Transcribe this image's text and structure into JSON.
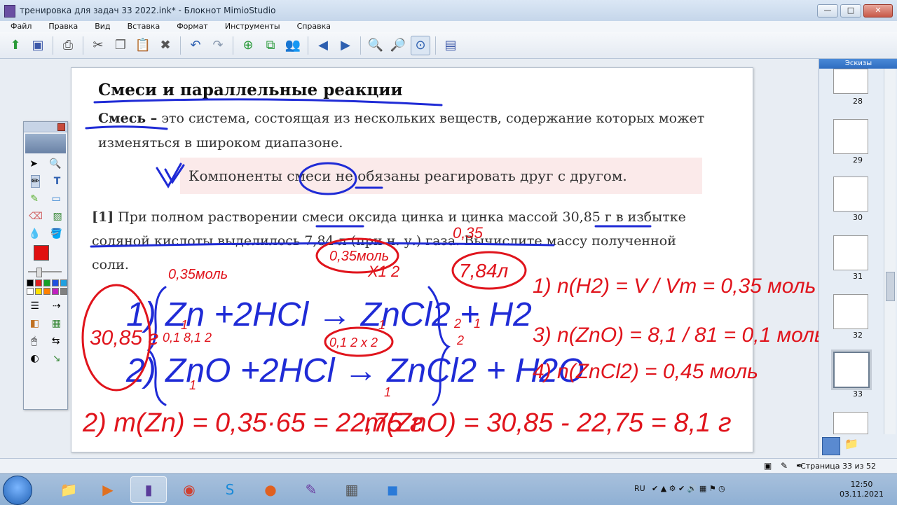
{
  "window": {
    "title": "тренировка для задач 33 2022.ink* - Блокнот MimioStudio",
    "buttons": [
      "—",
      "□",
      "✕"
    ]
  },
  "menu": [
    "Файл",
    "Правка",
    "Вид",
    "Вставка",
    "Формат",
    "Инструменты",
    "Справка"
  ],
  "toolbar": {
    "icons": [
      "open-icon",
      "save-icon",
      "print-icon",
      "cut-icon",
      "copy-icon",
      "paste-icon",
      "delete-icon",
      "undo-icon",
      "redo-icon",
      "new-page-icon",
      "duplicate-page-icon",
      "users-icon",
      "back-icon",
      "forward-icon",
      "zoom-in-icon",
      "zoom-out-icon",
      "zoom-fit-icon",
      "screen-icon"
    ]
  },
  "page": {
    "heading": "Смеси и параллельные реакции",
    "definition_term": "Смесь –",
    "definition_text": " это система, состоящая из нескольких веществ, содержание которых может изменяться в широком диапазоне.",
    "callout": "Компоненты смеси не обязаны реагировать друг с другом.",
    "problem_number": "[1]",
    "problem_text": " При полном растворении смеси оксида цинка и цинка массой 30,85 г в избытке соляной кислоты выделилось 7,84 л (при н. у.) газа. Вычислите массу полученной соли."
  },
  "ink": {
    "color_blue": "#1f2bd6",
    "color_red": "#e0141c",
    "texts": [
      "0,35моль",
      "0,35моль",
      "7,84л",
      "0,35",
      "X1 2",
      "1) Zn +2HCl → ZnCl2 + H2",
      "2) ZnO +2HCl → ZnCl2 + H2O",
      "0,1 8,1 2",
      "0,1 2 x 2",
      "30,85 г",
      "1) n(H2) = V / Vm = 0,35 моль",
      "3) n(ZnO) = 8,1 / 81 = 0,1 моль",
      "4) n(ZnCl2) = 0,45 моль",
      "2) m(Zn) = 0,35·65 = 22,75 г",
      "m(ZnO) = 30,85 - 22,75 = 8,1 г",
      "1",
      "1",
      "1",
      "1",
      "1",
      "2",
      "2"
    ]
  },
  "palette": {
    "colors": [
      "#000000",
      "#e02020",
      "#18a028",
      "#2050e0",
      "#20a0e0",
      "#ffffff",
      "#ffe000",
      "#ff8000",
      "#c020c0",
      "#808080"
    ],
    "current_color": "#e01010"
  },
  "thumbnails": {
    "header": "Эскизы",
    "pages": [
      "28",
      "29",
      "30",
      "31",
      "32",
      "33"
    ],
    "selected": "33"
  },
  "status": {
    "page_info": "Страница 33 из 52"
  },
  "taskbar": {
    "apps": [
      "explorer-icon",
      "media-player-icon",
      "mimio-notebook-icon",
      "chrome-icon",
      "skype-icon",
      "firefox-icon",
      "mimio-studio-icon",
      "calculator-icon",
      "zoom-icon"
    ],
    "language": "RU",
    "time": "12:50",
    "date": "03.11.2021"
  }
}
